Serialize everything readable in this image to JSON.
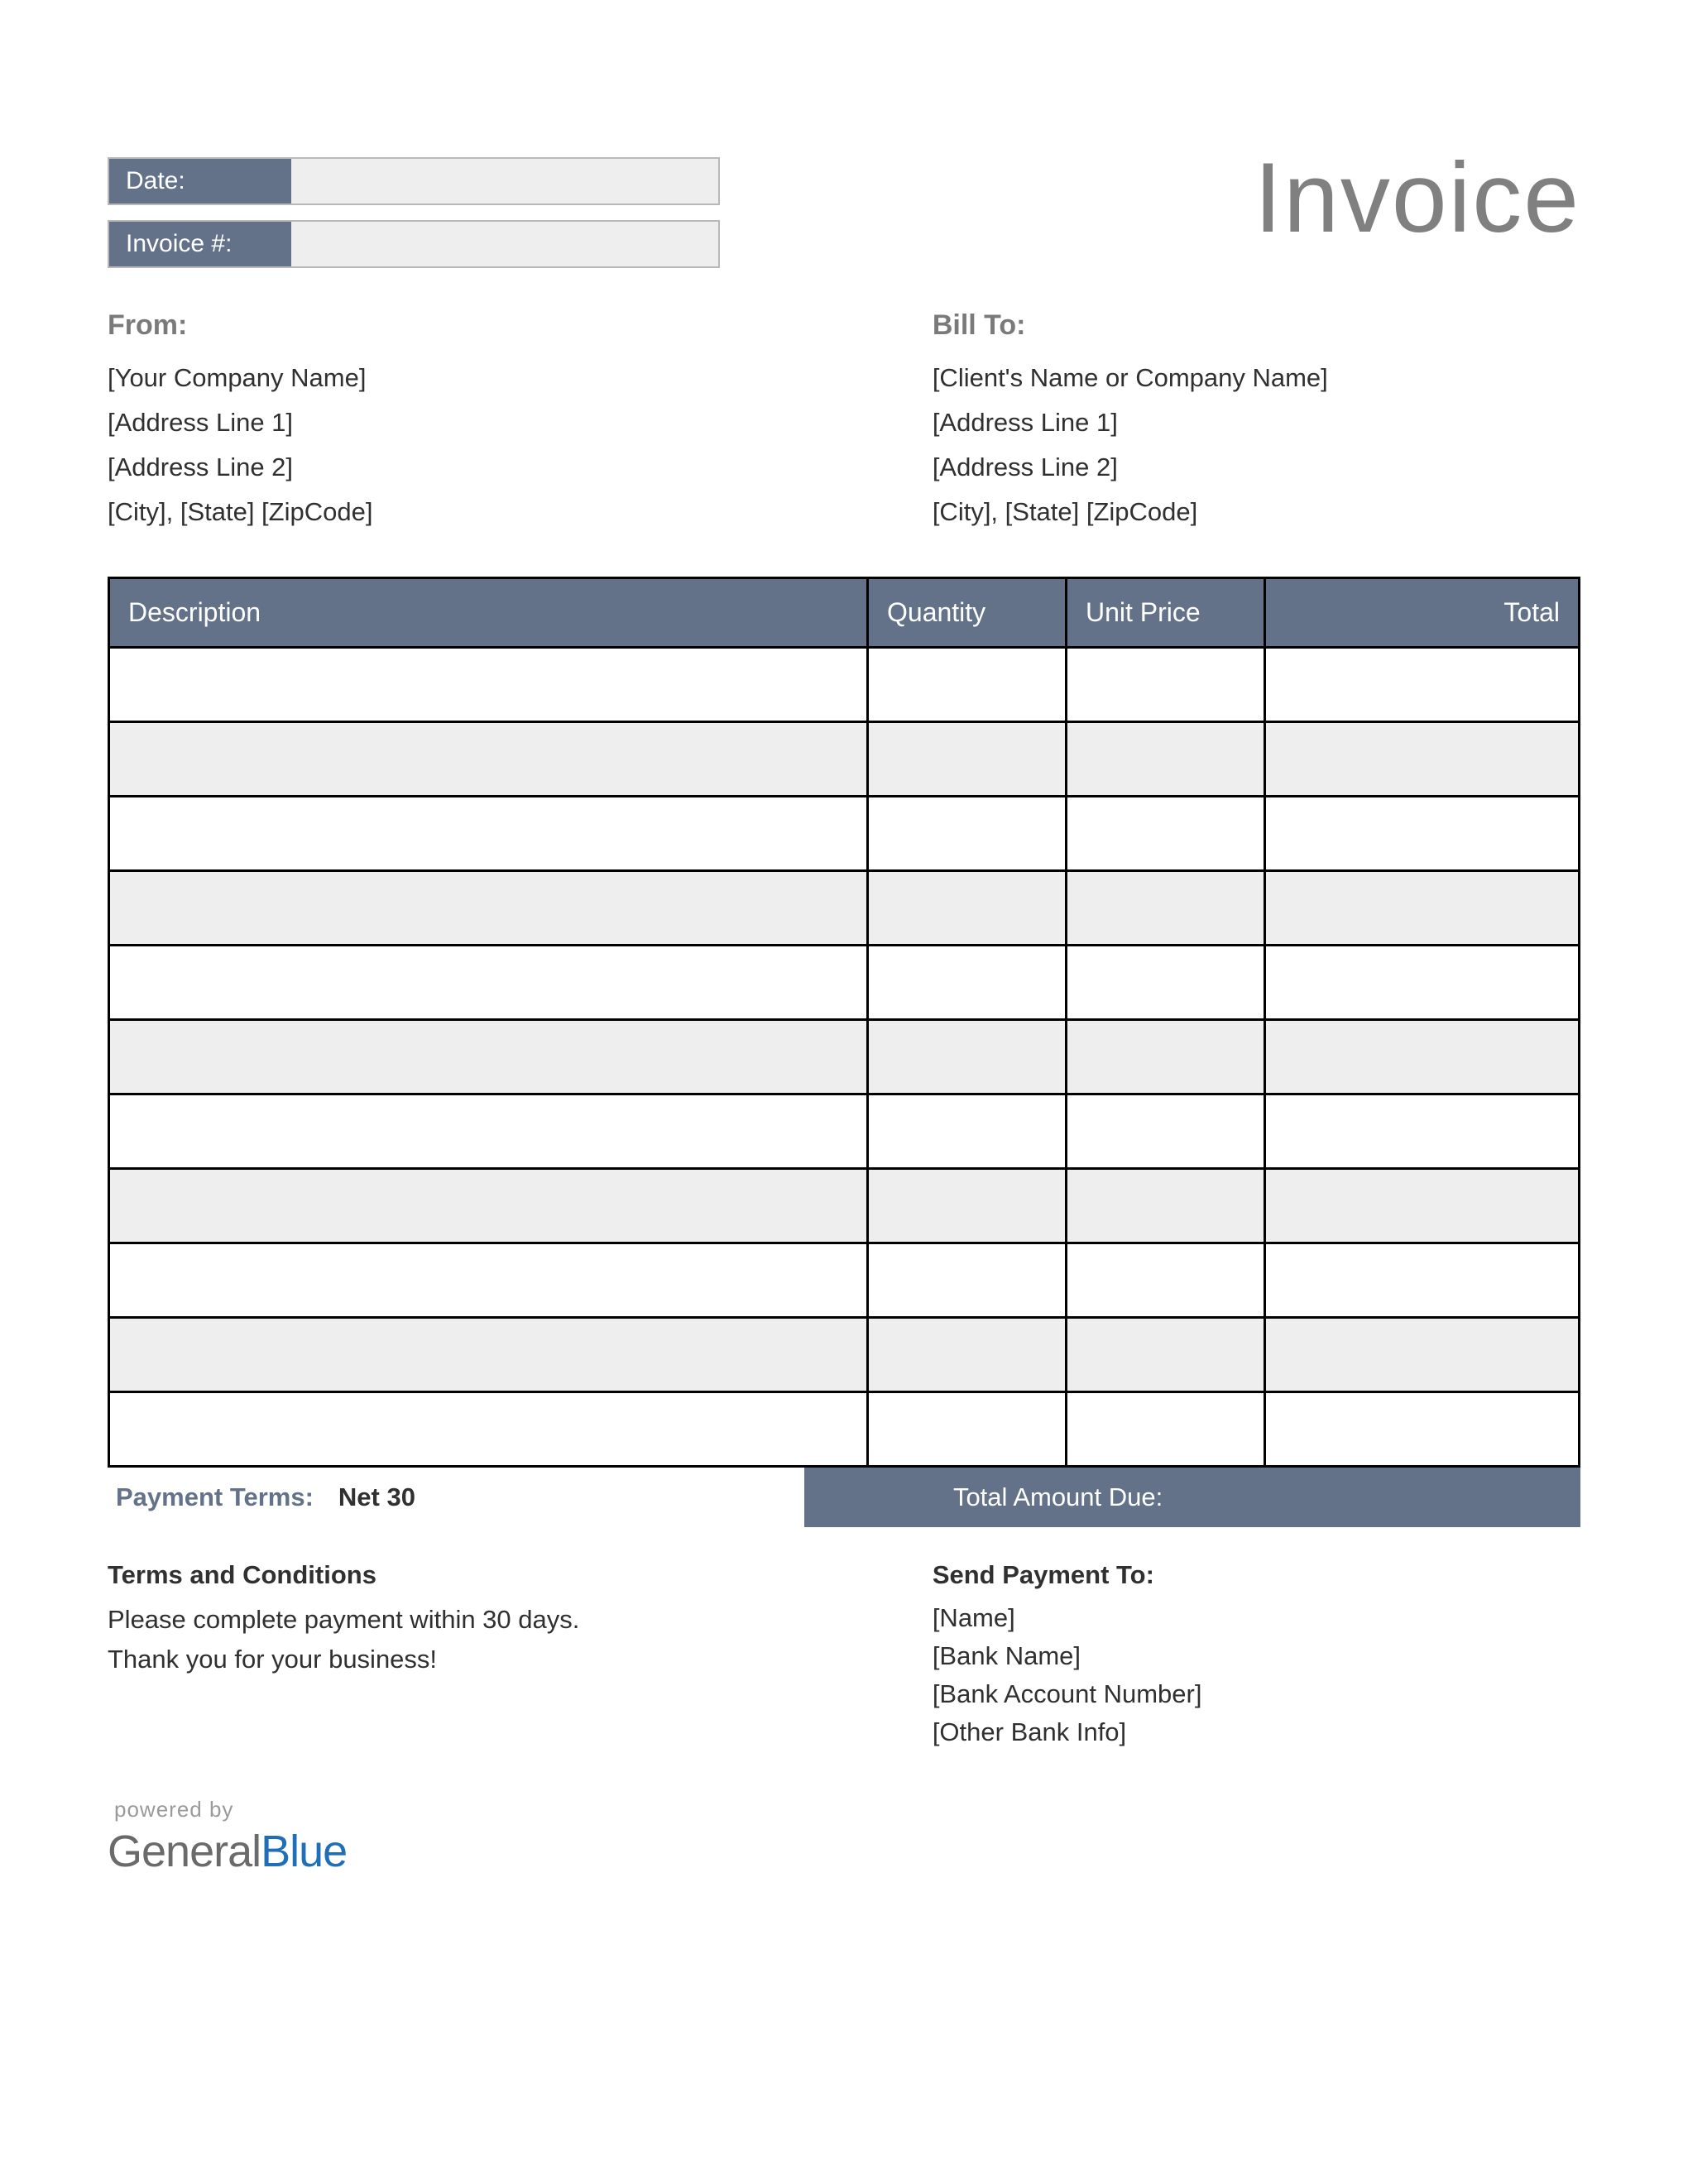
{
  "title": "Invoice",
  "meta": {
    "date_label": "Date:",
    "invoice_label": "Invoice #:"
  },
  "from": {
    "heading": "From:",
    "lines": [
      "[Your Company Name]",
      "[Address Line 1]",
      "[Address Line 2]",
      "[City], [State] [ZipCode]"
    ]
  },
  "bill_to": {
    "heading": "Bill To:",
    "lines": [
      "[Client's Name or Company Name]",
      "[Address Line 1]",
      "[Address Line 2]",
      "[City], [State] [ZipCode]"
    ]
  },
  "table": {
    "headers": {
      "description": "Description",
      "quantity": "Quantity",
      "unit_price": "Unit Price",
      "total": "Total"
    }
  },
  "payment_terms": {
    "label": "Payment Terms:",
    "value": "Net 30"
  },
  "total_due_label": "Total Amount Due:",
  "terms": {
    "heading": "Terms and Conditions",
    "line1": "Please complete payment within 30 days.",
    "line2": "Thank you for your business!"
  },
  "send_to": {
    "heading": "Send Payment To:",
    "lines": [
      "[Name]",
      "[Bank Name]",
      "[Bank Account Number]",
      "[Other Bank Info]"
    ]
  },
  "powered": {
    "label": "powered by",
    "general": "General",
    "blue": "Blue"
  }
}
